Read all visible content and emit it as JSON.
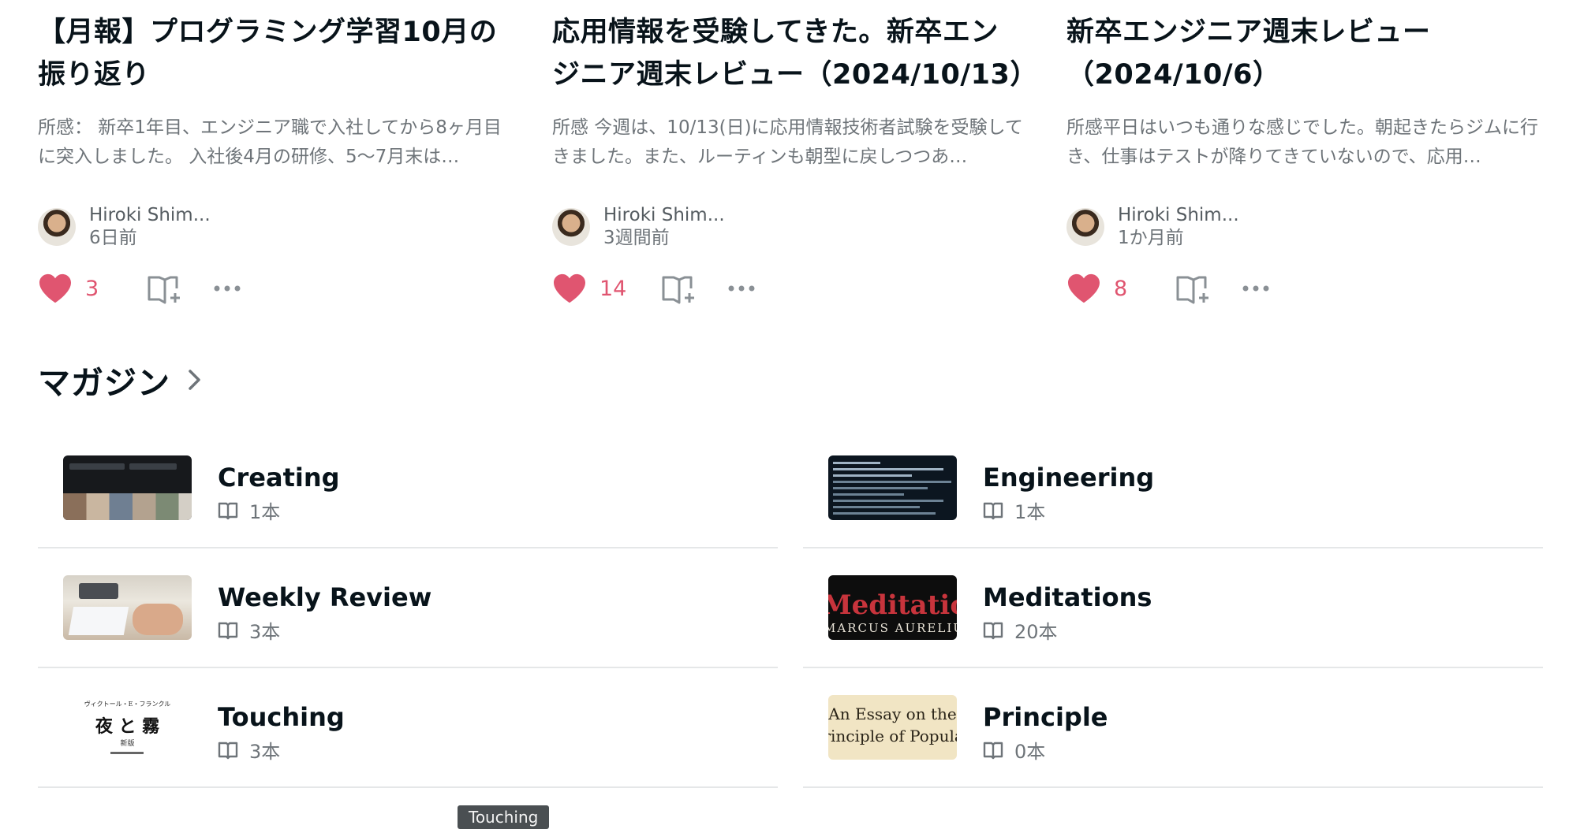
{
  "articles": [
    {
      "title": "【月報】プログラミング学習10月の振り返り",
      "excerpt": "所感： 新卒1年目、エンジニア職で入社してから8ヶ月目に突入しました。 入社後4月の研修、5〜7月末は…",
      "author": "Hiroki Shim...",
      "time": "6日前",
      "likes": "3"
    },
    {
      "title": "応用情報を受験してきた。新卒エンジニア週末レビュー（2024/10/13）",
      "excerpt": "所感 今週は、10/13(日)に応用情報技術者試験を受験してきました。また、ルーティンも朝型に戻しつつあ…",
      "author": "Hiroki Shim...",
      "time": "3週間前",
      "likes": "14"
    },
    {
      "title": "新卒エンジニア週末レビュー（2024/10/6）",
      "excerpt": "所感平日はいつも通りな感じでした。朝起きたらジムに行き、仕事はテストが降りてきていないので、応用…",
      "author": "Hiroki Shim...",
      "time": "1か月前",
      "likes": "8"
    }
  ],
  "magazines_section": {
    "title": "マガジン"
  },
  "magazines": [
    {
      "name": "Creating",
      "count": "1本"
    },
    {
      "name": "Engineering",
      "count": "1本"
    },
    {
      "name": "Weekly Review",
      "count": "3本"
    },
    {
      "name": "Meditations",
      "count": "20本"
    },
    {
      "name": "Touching",
      "count": "3本"
    },
    {
      "name": "Principle",
      "count": "0本"
    }
  ],
  "thumbs": {
    "meditations_text": "Meditations",
    "meditations_sub": "MARCUS AURELIUS",
    "touching_author": "ヴィクトール・E・フランクル",
    "touching_title": "夜 と 霧",
    "touching_sub": "新版",
    "principle_line1": "An Essay on the",
    "principle_line2": "Principle of Population"
  },
  "tooltip": "Touching",
  "colors": {
    "like": "#e05570",
    "text": "#08131a",
    "muted": "#6e7479",
    "divider": "#e5e7e8"
  }
}
